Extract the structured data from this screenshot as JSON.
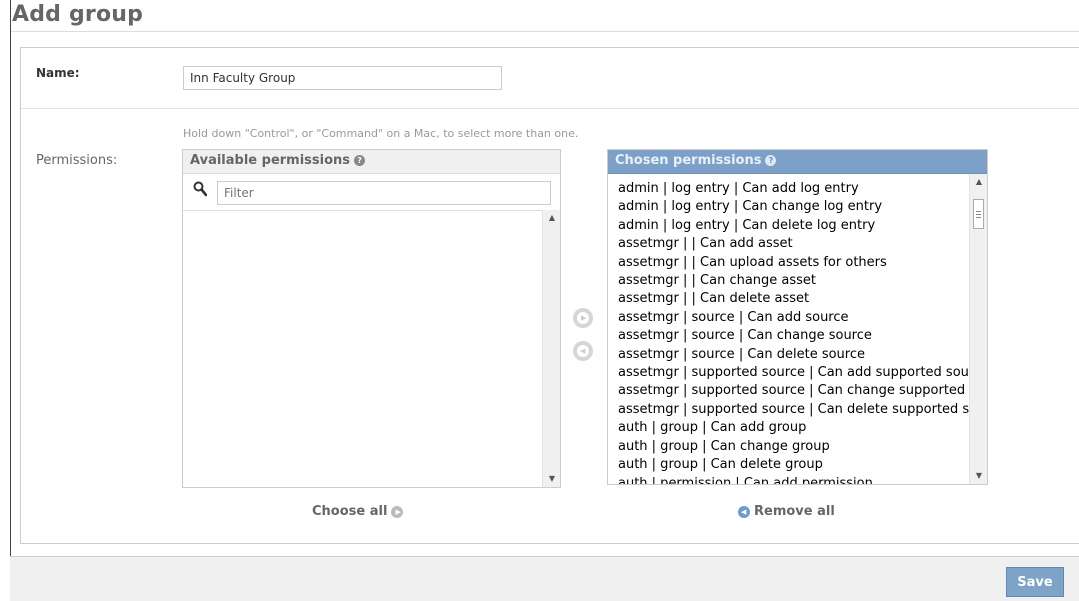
{
  "page": {
    "title": "Add group"
  },
  "form": {
    "name_label": "Name:",
    "name_value": "Inn Faculty Group",
    "permissions_label": "Permissions:",
    "help_text": "Hold down \"Control\", or \"Command\" on a Mac, to select more than one."
  },
  "available": {
    "title": "Available permissions",
    "filter_placeholder": "Filter",
    "choose_all_label": "Choose all"
  },
  "chosen": {
    "title": "Chosen permissions",
    "remove_all_label": "Remove all",
    "items": [
      "admin | log entry | Can add log entry",
      "admin | log entry | Can change log entry",
      "admin | log entry | Can delete log entry",
      "assetmgr | | Can add asset",
      "assetmgr | | Can upload assets for others",
      "assetmgr | | Can change asset",
      "assetmgr | | Can delete asset",
      "assetmgr | source | Can add source",
      "assetmgr | source | Can change source",
      "assetmgr | source | Can delete source",
      "assetmgr | supported source | Can add supported source",
      "assetmgr | supported source | Can change supported source",
      "assetmgr | supported source | Can delete supported source",
      "auth | group | Can add group",
      "auth | group | Can change group",
      "auth | group | Can delete group",
      "auth | permission | Can add permission"
    ]
  },
  "submit": {
    "save_label": "Save"
  },
  "colors": {
    "accent": "#7ca0c7",
    "save_bg": "#7ea3c9"
  },
  "icons": {
    "filter": "search-icon",
    "help": "help-icon",
    "add": "add-circle-icon",
    "remove": "remove-circle-icon"
  }
}
